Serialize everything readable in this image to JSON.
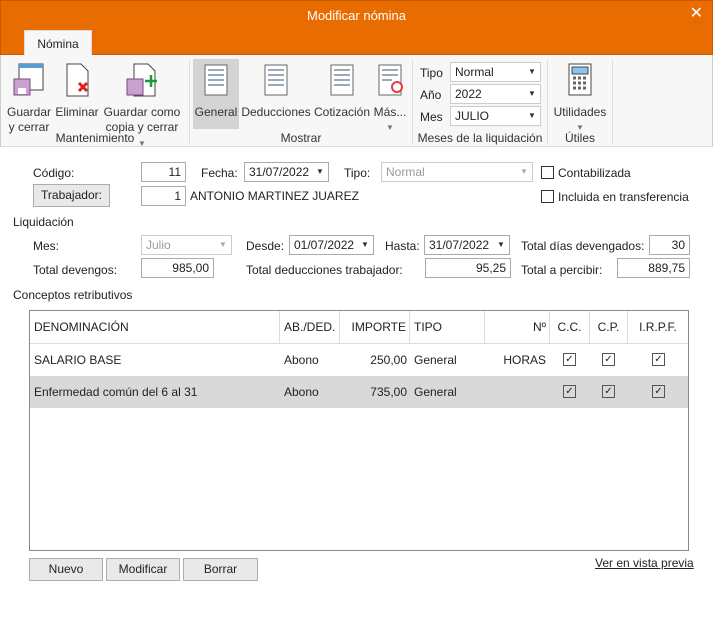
{
  "window": {
    "title": "Modificar nómina",
    "close": "✕"
  },
  "ribbon": {
    "tab": "Nómina",
    "mantenimiento": {
      "label": "Mantenimiento",
      "guardar": [
        "Guardar",
        "y cerrar"
      ],
      "eliminar": "Eliminar",
      "guardar_copia": [
        "Guardar como",
        "copia y cerrar"
      ]
    },
    "mostrar": {
      "label": "Mostrar",
      "general": "General",
      "deducciones": "Deducciones",
      "cotizacion": "Cotización",
      "mas": "Más..."
    },
    "meses": {
      "label": "Meses de la liquidación",
      "tipo_label": "Tipo",
      "tipo": "Normal",
      "ano_label": "Año",
      "ano": "2022",
      "mes_label": "Mes",
      "mes": "JULIO"
    },
    "utiles": {
      "label": "Útiles",
      "utilidades": "Utilidades"
    }
  },
  "form": {
    "codigo_label": "Código:",
    "codigo": "11",
    "fecha_label": "Fecha:",
    "fecha": "31/07/2022",
    "tipo_label": "Tipo:",
    "tipo": "Normal",
    "contabilizada": {
      "label": "Contabilizada",
      "checked": false
    },
    "transferencia": {
      "label": "Incluida en transferencia",
      "checked": false
    },
    "trabajador_button": "Trabajador:",
    "trabajador_id": "1",
    "trabajador_nombre": "ANTONIO MARTINEZ JUAREZ"
  },
  "liquidacion": {
    "label": "Liquidación",
    "mes_label": "Mes:",
    "mes": "Julio",
    "desde_label": "Desde:",
    "desde": "01/07/2022",
    "hasta_label": "Hasta:",
    "hasta": "31/07/2022",
    "dias_label": "Total días devengados:",
    "dias": "30",
    "devengos_label": "Total devengos:",
    "devengos": "985,00",
    "deducciones_label": "Total deducciones trabajador:",
    "deducciones": "95,25",
    "percibir_label": "Total a percibir:",
    "percibir": "889,75"
  },
  "conceptos": {
    "label": "Conceptos retributivos",
    "columns": [
      "DENOMINACIÓN",
      "AB./DED.",
      "IMPORTE",
      "TIPO",
      "Nº HORAS",
      "C.C.",
      "C.P.",
      "I.R.P.F."
    ],
    "rows": [
      {
        "denominacion": "SALARIO BASE",
        "abded": "Abono",
        "importe": "250,00",
        "tipo": "General",
        "horas": "",
        "cc": true,
        "cp": true,
        "irpf": true
      },
      {
        "denominacion": "Enfermedad común del 6 al 31",
        "abded": "Abono",
        "importe": "735,00",
        "tipo": "General",
        "horas": "",
        "cc": true,
        "cp": true,
        "irpf": true
      }
    ]
  },
  "actions": {
    "nuevo": "Nuevo",
    "modificar": "Modificar",
    "borrar": "Borrar",
    "vista_previa": "Ver en vista previa"
  },
  "colors": {
    "accent": "#e86c00",
    "selected_row": "#d9d9d9"
  }
}
